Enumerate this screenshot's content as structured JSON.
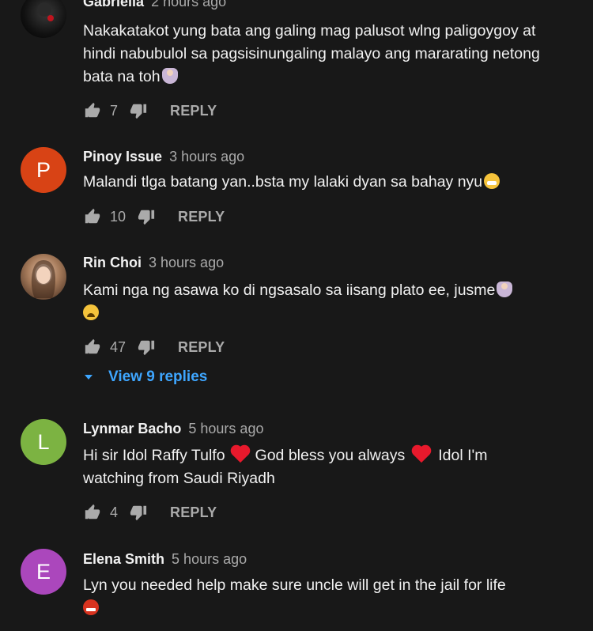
{
  "comments": [
    {
      "author": "Gabriella",
      "time": "2 hours ago",
      "avatar_letter": "",
      "avatar_color": "#111111",
      "text": "Nakakatakot yung bata ang galing mag palusot wlng paligoygoy at hindi nabubulol sa pagsisinungaling malayo ang mararating netong bata na toh",
      "likes": "7",
      "reply_label": "REPLY"
    },
    {
      "author": "Pinoy Issue",
      "time": "3 hours ago",
      "avatar_letter": "P",
      "avatar_color": "#d84315",
      "text": "Malandi tlga batang yan..bsta my lalaki dyan sa bahay nyu",
      "likes": "10",
      "reply_label": "REPLY"
    },
    {
      "author": "Rin Choi",
      "time": "3 hours ago",
      "avatar_letter": "",
      "avatar_color": "#8a5a3c",
      "text": "Kami nga ng asawa ko di ngsasalo sa iisang plato ee, jusme",
      "likes": "47",
      "reply_label": "REPLY"
    },
    {
      "author": "Lynmar Bacho",
      "time": "5 hours ago",
      "avatar_letter": "L",
      "avatar_color": "#7cb342",
      "text_parts": [
        "Hi sir Idol Raffy Tulfo",
        "God bless you always",
        "Idol I'm watching from Saudi Riyadh"
      ],
      "likes": "4",
      "reply_label": "REPLY"
    },
    {
      "author": "Elena Smith",
      "time": "5 hours ago",
      "avatar_letter": "E",
      "avatar_color": "#ab47bc",
      "text": "Lyn you needed help make sure uncle will get in the jail for life"
    }
  ],
  "view_replies_label": "View 9 replies",
  "icons": {
    "like": "thumbs-up-icon",
    "dislike": "thumbs-down-icon",
    "expand": "caret-down-icon"
  },
  "colors": {
    "background": "#181818",
    "text": "#f1f1f1",
    "secondary": "#aaaaaa",
    "link": "#3ea6ff"
  }
}
